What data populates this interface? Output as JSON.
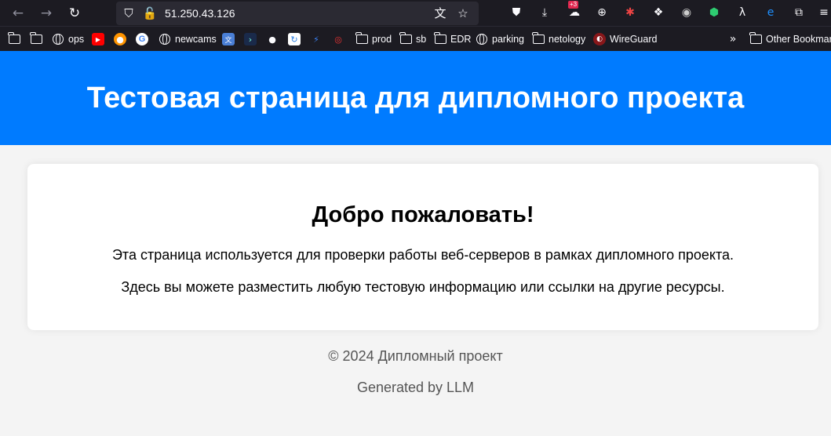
{
  "browser": {
    "url": "51.250.43.126",
    "bookmarks": [
      {
        "label": "",
        "icon": "folder-icon"
      },
      {
        "label": "",
        "icon": "folder-icon"
      },
      {
        "label": "ops",
        "icon": "globe-icon"
      },
      {
        "label": "",
        "icon": "youtube-icon"
      },
      {
        "label": "",
        "icon": "firefox-icon"
      },
      {
        "label": "",
        "icon": "google-icon"
      },
      {
        "label": "newcams",
        "icon": "globe-icon"
      },
      {
        "label": "",
        "icon": "translate-icon"
      },
      {
        "label": "",
        "icon": "terminal-icon"
      },
      {
        "label": "",
        "icon": "github-icon"
      },
      {
        "label": "",
        "icon": "sync-icon"
      },
      {
        "label": "",
        "icon": "bolt-icon"
      },
      {
        "label": "",
        "icon": "target-icon"
      },
      {
        "label": "prod",
        "icon": "folder-icon"
      },
      {
        "label": "sb",
        "icon": "folder-icon"
      },
      {
        "label": "EDR",
        "icon": "folder-icon"
      },
      {
        "label": "parking",
        "icon": "globe-icon"
      },
      {
        "label": "netology",
        "icon": "folder-icon"
      },
      {
        "label": "WireGuard",
        "icon": "wireguard-icon"
      }
    ],
    "other_bookmarks": "Other Bookmarks",
    "weather_badge": "+3"
  },
  "page": {
    "header_title": "Тестовая страница для дипломного проекта",
    "card_heading": "Добро пожаловать!",
    "card_text_1": "Эта страница используется для проверки работы веб-серверов в рамках дипломного проекта.",
    "card_text_2": "Здесь вы можете разместить любую тестовую информацию или ссылки на другие ресурсы.",
    "footer_copyright": "© 2024 Дипломный проект",
    "footer_generated": "Generated by LLM"
  },
  "colors": {
    "header_bg": "#007bff",
    "page_bg": "#f4f4f4",
    "chrome_bg": "#1c1b22"
  }
}
